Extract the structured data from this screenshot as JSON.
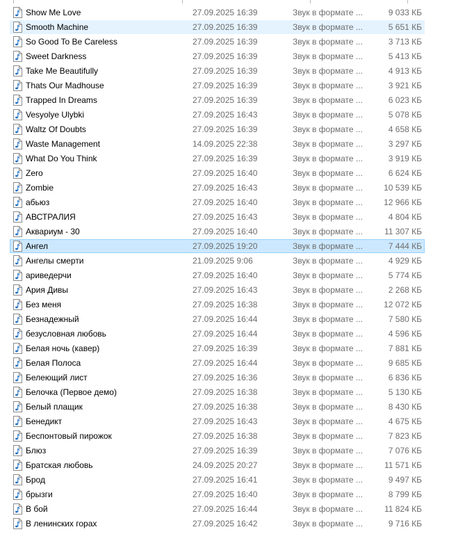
{
  "file_type_icon": "audio-file-icon",
  "rows": [
    {
      "name": "Show Me Love",
      "date": "27.09.2025 16:39",
      "type": "Звук в формате ...",
      "size": "9 033 КБ"
    },
    {
      "name": "Smooth Machine",
      "date": "27.09.2025 16:39",
      "type": "Звук в формате ...",
      "size": "5 651 КБ"
    },
    {
      "name": "So Good To Be Careless",
      "date": "27.09.2025 16:39",
      "type": "Звук в формате ...",
      "size": "3 713 КБ"
    },
    {
      "name": "Sweet Darkness",
      "date": "27.09.2025 16:39",
      "type": "Звук в формате ...",
      "size": "5 413 КБ"
    },
    {
      "name": "Take Me Beautifully",
      "date": "27.09.2025 16:39",
      "type": "Звук в формате ...",
      "size": "4 913 КБ"
    },
    {
      "name": "Thats Our Madhouse",
      "date": "27.09.2025 16:39",
      "type": "Звук в формате ...",
      "size": "3 921 КБ"
    },
    {
      "name": "Trapped In Dreams",
      "date": "27.09.2025 16:39",
      "type": "Звук в формате ...",
      "size": "6 023 КБ"
    },
    {
      "name": "Vesyolye Ulybki",
      "date": "27.09.2025 16:43",
      "type": "Звук в формате ...",
      "size": "5 078 КБ"
    },
    {
      "name": "Waltz Of Doubts",
      "date": "27.09.2025 16:39",
      "type": "Звук в формате ...",
      "size": "4 658 КБ"
    },
    {
      "name": "Waste Management",
      "date": "14.09.2025 22:38",
      "type": "Звук в формате ...",
      "size": "3 297 КБ"
    },
    {
      "name": "What Do You Think",
      "date": "27.09.2025 16:39",
      "type": "Звук в формате ...",
      "size": "3 919 КБ"
    },
    {
      "name": "Zero",
      "date": "27.09.2025 16:40",
      "type": "Звук в формате ...",
      "size": "6 624 КБ"
    },
    {
      "name": "Zombie",
      "date": "27.09.2025 16:43",
      "type": "Звук в формате ...",
      "size": "10 539 КБ"
    },
    {
      "name": "абьюз",
      "date": "27.09.2025 16:40",
      "type": "Звук в формате ...",
      "size": "12 966 КБ"
    },
    {
      "name": "АВСТРАЛИЯ",
      "date": "27.09.2025 16:43",
      "type": "Звук в формате ...",
      "size": "4 804 КБ"
    },
    {
      "name": "Аквариум - 30",
      "date": "27.09.2025 16:40",
      "type": "Звук в формате ...",
      "size": "11 307 КБ"
    },
    {
      "name": "Ангел",
      "date": "27.09.2025 19:20",
      "type": "Звук в формате ...",
      "size": "7 444 КБ"
    },
    {
      "name": "Ангелы смерти",
      "date": "21.09.2025 9:06",
      "type": "Звук в формате ...",
      "size": "4 929 КБ"
    },
    {
      "name": "ариведерчи",
      "date": "27.09.2025 16:40",
      "type": "Звук в формате ...",
      "size": "5 774 КБ"
    },
    {
      "name": "Ария Дивы",
      "date": "27.09.2025 16:43",
      "type": "Звук в формате ...",
      "size": "2 268 КБ"
    },
    {
      "name": "Без меня",
      "date": "27.09.2025 16:38",
      "type": "Звук в формате ...",
      "size": "12 072 КБ"
    },
    {
      "name": "Безнадежный",
      "date": "27.09.2025 16:44",
      "type": "Звук в формате ...",
      "size": "7 580 КБ"
    },
    {
      "name": "безусловная любовь",
      "date": "27.09.2025 16:44",
      "type": "Звук в формате ...",
      "size": "4 596 КБ"
    },
    {
      "name": "Белая ночь (кавер)",
      "date": "27.09.2025 16:39",
      "type": "Звук в формате ...",
      "size": "7 881 КБ"
    },
    {
      "name": "Белая Полоса",
      "date": "27.09.2025 16:44",
      "type": "Звук в формате ...",
      "size": "9 685 КБ"
    },
    {
      "name": "Белеющий лист",
      "date": "27.09.2025 16:36",
      "type": "Звук в формате ...",
      "size": "6 836 КБ"
    },
    {
      "name": "Белочка (Первое демо)",
      "date": "27.09.2025 16:38",
      "type": "Звук в формате ...",
      "size": "5 130 КБ"
    },
    {
      "name": "Белый плащик",
      "date": "27.09.2025 16:38",
      "type": "Звук в формате ...",
      "size": "8 430 КБ"
    },
    {
      "name": "Бенедикт",
      "date": "27.09.2025 16:43",
      "type": "Звук в формате ...",
      "size": "4 675 КБ"
    },
    {
      "name": "Беспонтовый пирожок",
      "date": "27.09.2025 16:38",
      "type": "Звук в формате ...",
      "size": "7 823 КБ"
    },
    {
      "name": "Блюз",
      "date": "27.09.2025 16:39",
      "type": "Звук в формате ...",
      "size": "7 076 КБ"
    },
    {
      "name": "Братская любовь",
      "date": "24.09.2025 20:27",
      "type": "Звук в формате ...",
      "size": "11 571 КБ"
    },
    {
      "name": "Брод",
      "date": "27.09.2025 16:41",
      "type": "Звук в формате ...",
      "size": "9 497 КБ"
    },
    {
      "name": "брызги",
      "date": "27.09.2025 16:40",
      "type": "Звук в формате ...",
      "size": "8 799 КБ"
    },
    {
      "name": "В бой",
      "date": "27.09.2025 16:44",
      "type": "Звук в формате ...",
      "size": "11 824 КБ"
    },
    {
      "name": "В ленинских горах",
      "date": "27.09.2025 16:42",
      "type": "Звук в формате ...",
      "size": "9 716 КБ"
    }
  ],
  "hovered_row_index": 1,
  "selected_row_index": 16
}
